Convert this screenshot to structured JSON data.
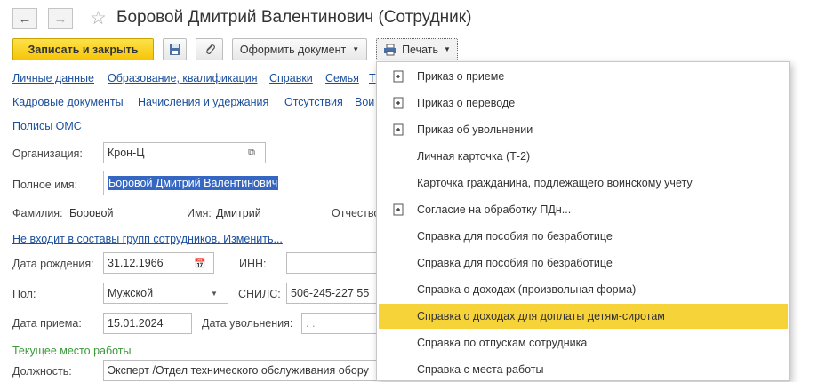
{
  "window": {
    "title": "Боровой Дмитрий Валентинович (Сотрудник)"
  },
  "toolbar": {
    "save_close": "Записать и закрыть",
    "issue_doc": "Оформить документ",
    "print": "Печать"
  },
  "links_row1": [
    "Личные данные",
    "Образование, квалификация",
    "Справки",
    "Семья",
    "Т"
  ],
  "links_row2": [
    "Кадровые документы",
    "Начисления и удержания",
    "Отсутствия",
    "Вои"
  ],
  "links_row3": [
    "Полисы ОМС"
  ],
  "form": {
    "org_label": "Организация:",
    "org_value": "Крон-Ц",
    "fullname_label": "Полное имя:",
    "fullname_value": "Боровой Дмитрий Валентинович",
    "surname_label": "Фамилия:",
    "surname_value": "Боровой",
    "name_label": "Имя:",
    "name_value": "Дмитрий",
    "patronymic_label": "Отчество",
    "groups_link": "Не входит в составы групп сотрудников. Изменить...",
    "birth_label": "Дата рождения:",
    "birth_value": "31.12.1966",
    "inn_label": "ИНН:",
    "inn_value": "",
    "gender_label": "Пол:",
    "gender_value": "Мужской",
    "snils_label": "СНИЛС:",
    "snils_value": "506-245-227 55",
    "hire_label": "Дата приема:",
    "hire_value": "15.01.2024",
    "dismiss_label": "Дата увольнения:",
    "dismiss_value": ". .",
    "workplace_header": "Текущее место работы",
    "position_label": "Должность:",
    "position_value": "Эксперт /Отдел технического обслуживания обору"
  },
  "print_menu": {
    "items": [
      {
        "label": "Приказ о приеме",
        "icon": "print-doc-icon"
      },
      {
        "label": "Приказ о переводе",
        "icon": "print-doc-icon"
      },
      {
        "label": "Приказ об увольнении",
        "icon": "print-doc-icon"
      },
      {
        "label": "Личная карточка (Т-2)",
        "icon": ""
      },
      {
        "label": "Карточка гражданина, подлежащего воинскому учету",
        "icon": ""
      },
      {
        "label": "Согласие на обработку ПДн...",
        "icon": "print-doc-icon"
      },
      {
        "label": "Справка для пособия по безработице",
        "icon": ""
      },
      {
        "label": "Справка для пособия по безработице",
        "icon": ""
      },
      {
        "label": "Справка о доходах (произвольная форма)",
        "icon": ""
      },
      {
        "label": "Справка о доходах для доплаты детям-сиротам",
        "icon": ""
      },
      {
        "label": "Справка по отпускам сотрудника",
        "icon": ""
      },
      {
        "label": "Справка с места работы",
        "icon": ""
      }
    ],
    "selected_index": 9
  },
  "colors": {
    "accent": "#f6c508",
    "highlight": "#f7d33a",
    "link": "#1a4f9c",
    "section": "#3a9a3a"
  }
}
